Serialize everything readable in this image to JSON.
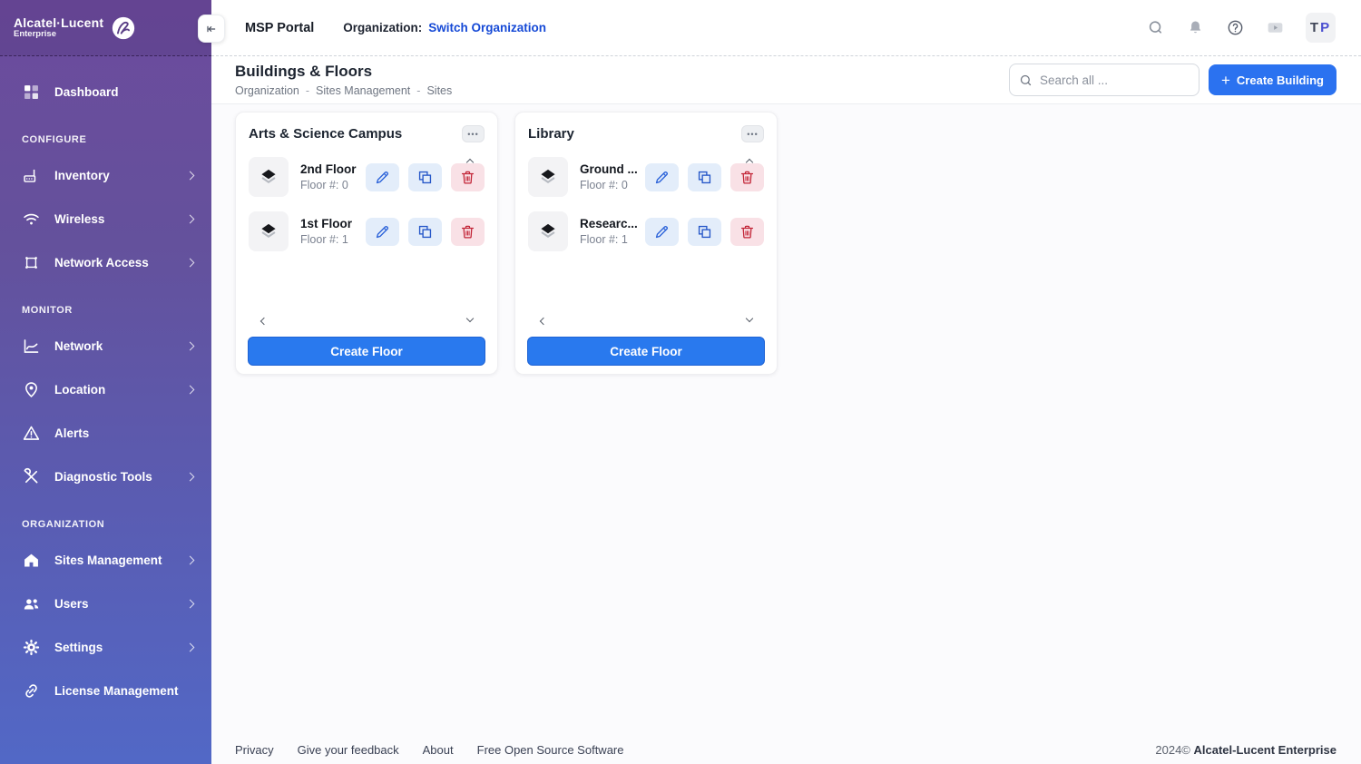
{
  "colors": {
    "accent_blue": "#2b72f0",
    "create_floor_blue": "#2979ee",
    "org_link_blue": "#1549d6",
    "sidebar_gradient_top": "#6c4b9d",
    "sidebar_gradient_bottom": "#5268c6",
    "action_icon_blue": "#2b62d9",
    "action_icon_red": "#c22436"
  },
  "icons": {
    "plus": "+",
    "ellipsis": "•••"
  },
  "sidebar": {
    "brand_line1": "Alcatel·Lucent",
    "brand_line2": "Enterprise",
    "sections": [
      {
        "items": [
          {
            "label": "Dashboard",
            "has_chevron": false
          }
        ]
      },
      {
        "label": "CONFIGURE",
        "items": [
          {
            "label": "Inventory",
            "has_chevron": true
          },
          {
            "label": "Wireless",
            "has_chevron": true
          },
          {
            "label": "Network Access",
            "has_chevron": true
          }
        ]
      },
      {
        "label": "MONITOR",
        "items": [
          {
            "label": "Network",
            "has_chevron": true
          },
          {
            "label": "Location",
            "has_chevron": true
          },
          {
            "label": "Alerts",
            "has_chevron": false
          },
          {
            "label": "Diagnostic Tools",
            "has_chevron": true
          }
        ]
      },
      {
        "label": "ORGANIZATION",
        "items": [
          {
            "label": "Sites Management",
            "has_chevron": true
          },
          {
            "label": "Users",
            "has_chevron": true
          },
          {
            "label": "Settings",
            "has_chevron": true
          },
          {
            "label": "License Management",
            "has_chevron": false
          }
        ]
      }
    ]
  },
  "topbar": {
    "app_title": "MSP Portal",
    "org_label": "Organization:",
    "org_link": "Switch Organization",
    "avatar_initials": "TP"
  },
  "page_header": {
    "title": "Buildings & Floors",
    "breadcrumb": [
      "Organization",
      "Sites Management",
      "Sites"
    ],
    "breadcrumb_sep": "-",
    "search_placeholder": "Search all ...",
    "create_building_label": "Create Building"
  },
  "buildings": [
    {
      "name": "Arts & Science Campus",
      "create_floor_label": "Create Floor",
      "floors": [
        {
          "name": "2nd Floor",
          "floor_label": "Floor #: 0"
        },
        {
          "name": "1st Floor",
          "floor_label": "Floor #: 1"
        }
      ]
    },
    {
      "name": "Library",
      "create_floor_label": "Create Floor",
      "floors": [
        {
          "name": "Ground ...",
          "floor_label": "Floor #: 0"
        },
        {
          "name": "Researc...",
          "floor_label": "Floor #: 1"
        }
      ]
    }
  ],
  "footer": {
    "links": [
      "Privacy",
      "Give your feedback",
      "About",
      "Free Open Source Software"
    ],
    "copyright_year": "2024©",
    "copyright_company": "Alcatel-Lucent Enterprise"
  }
}
